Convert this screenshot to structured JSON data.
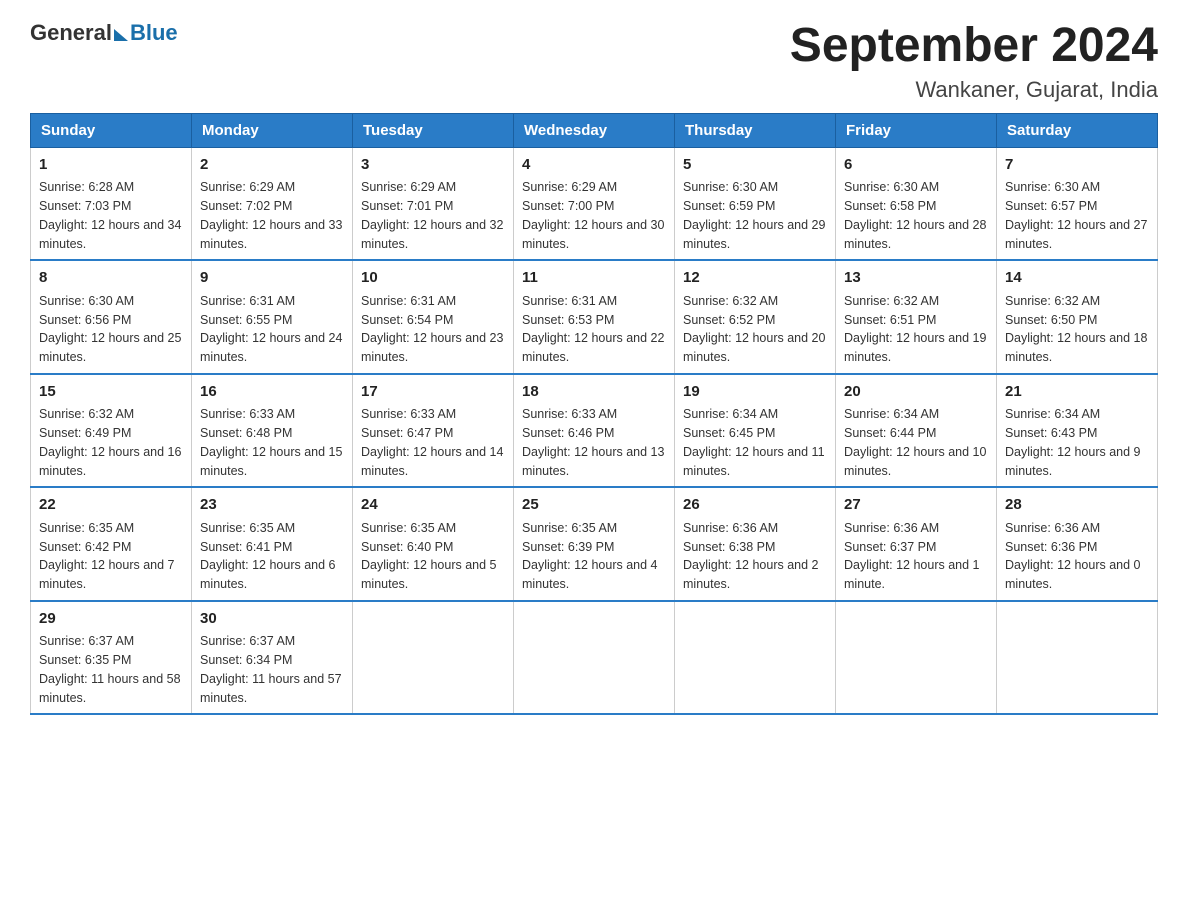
{
  "logo": {
    "text_general": "General",
    "text_blue": "Blue"
  },
  "header": {
    "month_year": "September 2024",
    "location": "Wankaner, Gujarat, India"
  },
  "columns": [
    "Sunday",
    "Monday",
    "Tuesday",
    "Wednesday",
    "Thursday",
    "Friday",
    "Saturday"
  ],
  "weeks": [
    [
      {
        "day": "1",
        "sunrise": "6:28 AM",
        "sunset": "7:03 PM",
        "daylight": "12 hours and 34 minutes."
      },
      {
        "day": "2",
        "sunrise": "6:29 AM",
        "sunset": "7:02 PM",
        "daylight": "12 hours and 33 minutes."
      },
      {
        "day": "3",
        "sunrise": "6:29 AM",
        "sunset": "7:01 PM",
        "daylight": "12 hours and 32 minutes."
      },
      {
        "day": "4",
        "sunrise": "6:29 AM",
        "sunset": "7:00 PM",
        "daylight": "12 hours and 30 minutes."
      },
      {
        "day": "5",
        "sunrise": "6:30 AM",
        "sunset": "6:59 PM",
        "daylight": "12 hours and 29 minutes."
      },
      {
        "day": "6",
        "sunrise": "6:30 AM",
        "sunset": "6:58 PM",
        "daylight": "12 hours and 28 minutes."
      },
      {
        "day": "7",
        "sunrise": "6:30 AM",
        "sunset": "6:57 PM",
        "daylight": "12 hours and 27 minutes."
      }
    ],
    [
      {
        "day": "8",
        "sunrise": "6:30 AM",
        "sunset": "6:56 PM",
        "daylight": "12 hours and 25 minutes."
      },
      {
        "day": "9",
        "sunrise": "6:31 AM",
        "sunset": "6:55 PM",
        "daylight": "12 hours and 24 minutes."
      },
      {
        "day": "10",
        "sunrise": "6:31 AM",
        "sunset": "6:54 PM",
        "daylight": "12 hours and 23 minutes."
      },
      {
        "day": "11",
        "sunrise": "6:31 AM",
        "sunset": "6:53 PM",
        "daylight": "12 hours and 22 minutes."
      },
      {
        "day": "12",
        "sunrise": "6:32 AM",
        "sunset": "6:52 PM",
        "daylight": "12 hours and 20 minutes."
      },
      {
        "day": "13",
        "sunrise": "6:32 AM",
        "sunset": "6:51 PM",
        "daylight": "12 hours and 19 minutes."
      },
      {
        "day": "14",
        "sunrise": "6:32 AM",
        "sunset": "6:50 PM",
        "daylight": "12 hours and 18 minutes."
      }
    ],
    [
      {
        "day": "15",
        "sunrise": "6:32 AM",
        "sunset": "6:49 PM",
        "daylight": "12 hours and 16 minutes."
      },
      {
        "day": "16",
        "sunrise": "6:33 AM",
        "sunset": "6:48 PM",
        "daylight": "12 hours and 15 minutes."
      },
      {
        "day": "17",
        "sunrise": "6:33 AM",
        "sunset": "6:47 PM",
        "daylight": "12 hours and 14 minutes."
      },
      {
        "day": "18",
        "sunrise": "6:33 AM",
        "sunset": "6:46 PM",
        "daylight": "12 hours and 13 minutes."
      },
      {
        "day": "19",
        "sunrise": "6:34 AM",
        "sunset": "6:45 PM",
        "daylight": "12 hours and 11 minutes."
      },
      {
        "day": "20",
        "sunrise": "6:34 AM",
        "sunset": "6:44 PM",
        "daylight": "12 hours and 10 minutes."
      },
      {
        "day": "21",
        "sunrise": "6:34 AM",
        "sunset": "6:43 PM",
        "daylight": "12 hours and 9 minutes."
      }
    ],
    [
      {
        "day": "22",
        "sunrise": "6:35 AM",
        "sunset": "6:42 PM",
        "daylight": "12 hours and 7 minutes."
      },
      {
        "day": "23",
        "sunrise": "6:35 AM",
        "sunset": "6:41 PM",
        "daylight": "12 hours and 6 minutes."
      },
      {
        "day": "24",
        "sunrise": "6:35 AM",
        "sunset": "6:40 PM",
        "daylight": "12 hours and 5 minutes."
      },
      {
        "day": "25",
        "sunrise": "6:35 AM",
        "sunset": "6:39 PM",
        "daylight": "12 hours and 4 minutes."
      },
      {
        "day": "26",
        "sunrise": "6:36 AM",
        "sunset": "6:38 PM",
        "daylight": "12 hours and 2 minutes."
      },
      {
        "day": "27",
        "sunrise": "6:36 AM",
        "sunset": "6:37 PM",
        "daylight": "12 hours and 1 minute."
      },
      {
        "day": "28",
        "sunrise": "6:36 AM",
        "sunset": "6:36 PM",
        "daylight": "12 hours and 0 minutes."
      }
    ],
    [
      {
        "day": "29",
        "sunrise": "6:37 AM",
        "sunset": "6:35 PM",
        "daylight": "11 hours and 58 minutes."
      },
      {
        "day": "30",
        "sunrise": "6:37 AM",
        "sunset": "6:34 PM",
        "daylight": "11 hours and 57 minutes."
      },
      null,
      null,
      null,
      null,
      null
    ]
  ]
}
